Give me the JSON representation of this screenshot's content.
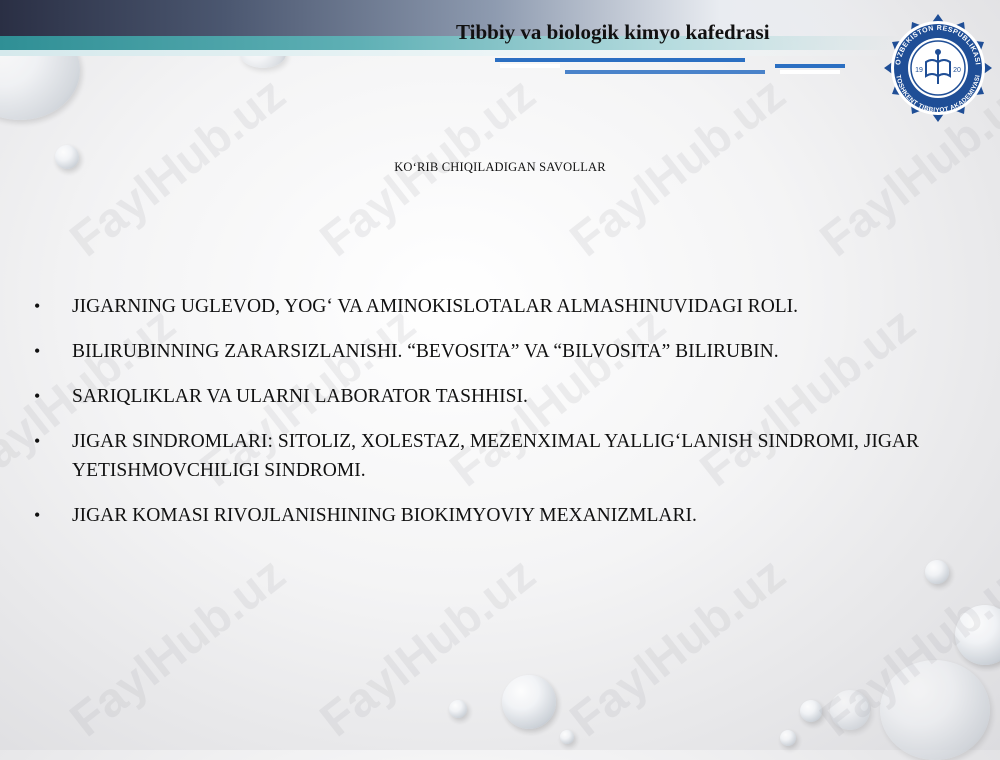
{
  "header": {
    "department": "Tibbiy va biologik kimyo kafedrasi"
  },
  "logo": {
    "text_top": "O'ZBEKISTON RESPUBLIKASI",
    "text_bottom": "TOSHKENT TIBBIYOT AKADEMIYASI",
    "year_left": "19",
    "year_right": "20",
    "color": "#1f4e96"
  },
  "watermark": {
    "text": "FaylHub.uz"
  },
  "slide": {
    "subtitle": "KO‘RIB CHIQILADIGAN SAVOLLAR",
    "bullet_glyph": "•",
    "items": [
      "JIGARNING UGLEVOD, YOG‘ VA AMINOKISLOTALAR ALMASHINUVIDAGI ROLI.",
      "BILIRUBINNING ZARARSIZLANISHI. “BEVOSITA” VA “BILVOSITA” BILIRUBIN.",
      "SARIQLIKLAR VA ULARNI LABORATOR TASHHISI.",
      "JIGAR SINDROMLARI: SITOLIZ, XOLESTAZ, MEZENXIMAL YALLIG‘LANISH SINDROMI, JIGAR YETISHMOVCHILIGI SINDROMI.",
      "JIGAR KOMASI RIVOJLANISHINING BIOKIMYOVIY MEXANIZMLARI."
    ]
  },
  "colors": {
    "header_dark": "#2a2f44",
    "header_teal": "#2f8f95",
    "stripe_blue": "#2b6fc2"
  }
}
